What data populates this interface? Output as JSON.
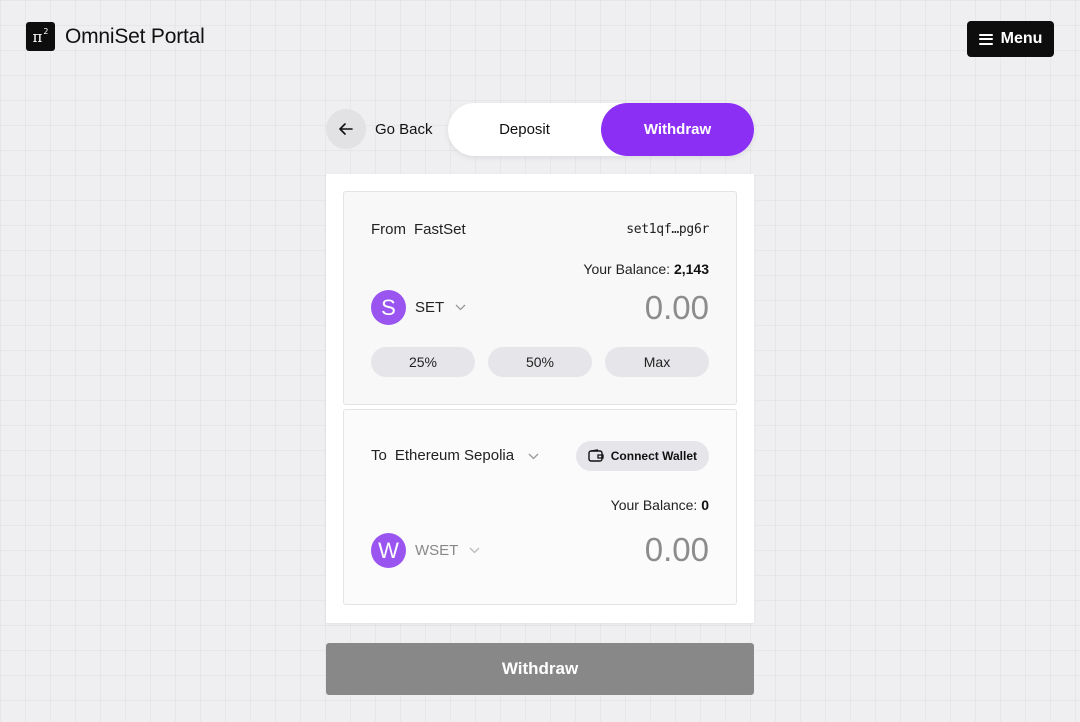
{
  "header": {
    "logo_glyph": "π",
    "logo_sup": "2",
    "title": "OmniSet Portal",
    "menu_label": "Menu"
  },
  "nav": {
    "back_label": "Go Back",
    "tabs": [
      {
        "label": "Deposit",
        "active": false
      },
      {
        "label": "Withdraw",
        "active": true
      }
    ]
  },
  "from": {
    "label": "From",
    "network": "FastSet",
    "address": "set1qf…pg6r",
    "balance_label": "Your Balance:",
    "balance_value": "2,143",
    "token_letter": "S",
    "token_name": "SET",
    "amount_placeholder": "0.00",
    "presets": [
      "25%",
      "50%",
      "Max"
    ]
  },
  "to": {
    "label": "To",
    "network": "Ethereum Sepolia",
    "connect_label": "Connect Wallet",
    "balance_label": "Your Balance:",
    "balance_value": "0",
    "token_letter": "W",
    "token_name": "WSET",
    "amount_placeholder": "0.00"
  },
  "action": {
    "submit_label": "Withdraw"
  },
  "colors": {
    "accent": "#8b2ff5",
    "token": "#9a55f0",
    "disabled_button": "#888888"
  }
}
